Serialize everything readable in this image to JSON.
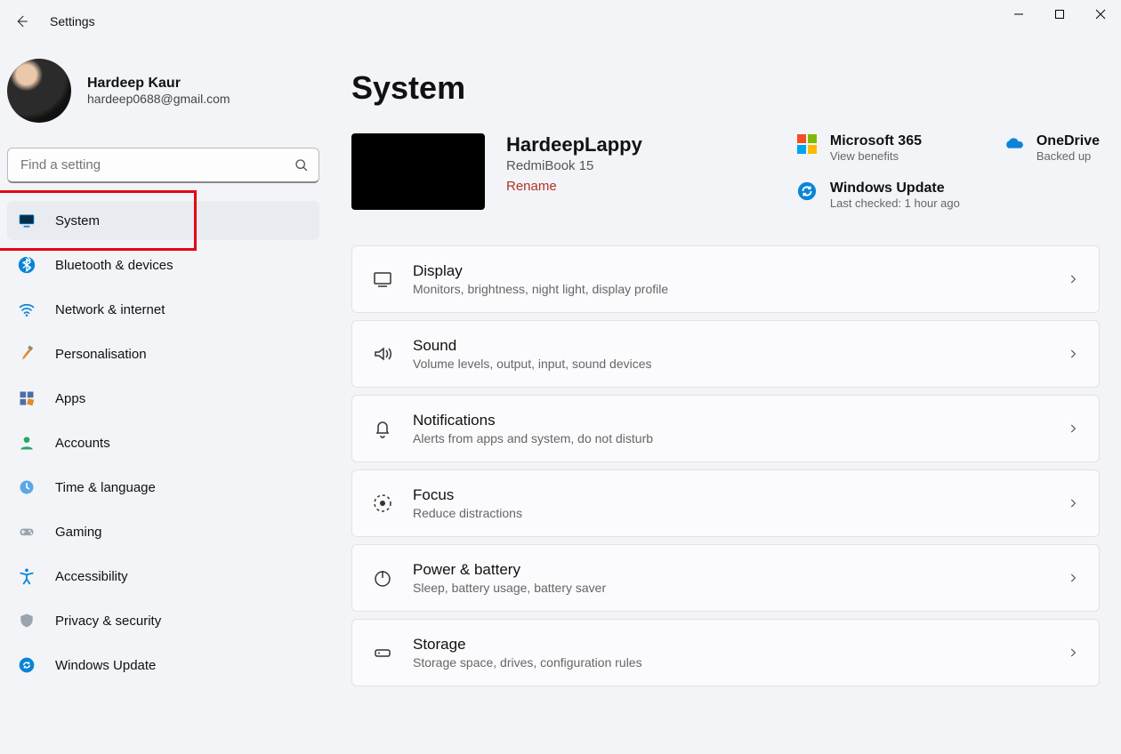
{
  "window": {
    "title": "Settings"
  },
  "profile": {
    "name": "Hardeep Kaur",
    "email": "hardeep0688@gmail.com"
  },
  "search": {
    "placeholder": "Find a setting"
  },
  "sidebar": {
    "items": [
      {
        "label": "System",
        "icon": "monitor",
        "selected": true
      },
      {
        "label": "Bluetooth & devices",
        "icon": "bluetooth",
        "selected": false
      },
      {
        "label": "Network & internet",
        "icon": "wifi",
        "selected": false
      },
      {
        "label": "Personalisation",
        "icon": "brush",
        "selected": false
      },
      {
        "label": "Apps",
        "icon": "apps",
        "selected": false
      },
      {
        "label": "Accounts",
        "icon": "person",
        "selected": false
      },
      {
        "label": "Time & language",
        "icon": "clock",
        "selected": false
      },
      {
        "label": "Gaming",
        "icon": "gamepad",
        "selected": false
      },
      {
        "label": "Accessibility",
        "icon": "accessibility",
        "selected": false
      },
      {
        "label": "Privacy & security",
        "icon": "shield",
        "selected": false
      },
      {
        "label": "Windows Update",
        "icon": "update",
        "selected": false
      }
    ]
  },
  "page": {
    "heading": "System",
    "device": {
      "name": "HardeepLappy",
      "model": "RedmiBook 15",
      "rename_label": "Rename"
    },
    "status": {
      "ms365": {
        "title": "Microsoft 365",
        "subtitle": "View benefits"
      },
      "onedrive": {
        "title": "OneDrive",
        "subtitle": "Backed up"
      },
      "update": {
        "title": "Windows Update",
        "subtitle": "Last checked: 1 hour ago"
      }
    },
    "cards": [
      {
        "id": "display",
        "title": "Display",
        "desc": "Monitors, brightness, night light, display profile"
      },
      {
        "id": "sound",
        "title": "Sound",
        "desc": "Volume levels, output, input, sound devices"
      },
      {
        "id": "notifications",
        "title": "Notifications",
        "desc": "Alerts from apps and system, do not disturb"
      },
      {
        "id": "focus",
        "title": "Focus",
        "desc": "Reduce distractions"
      },
      {
        "id": "power",
        "title": "Power & battery",
        "desc": "Sleep, battery usage, battery saver"
      },
      {
        "id": "storage",
        "title": "Storage",
        "desc": "Storage space, drives, configuration rules"
      }
    ]
  },
  "highlight": {
    "target": "sidebar-item-system"
  }
}
